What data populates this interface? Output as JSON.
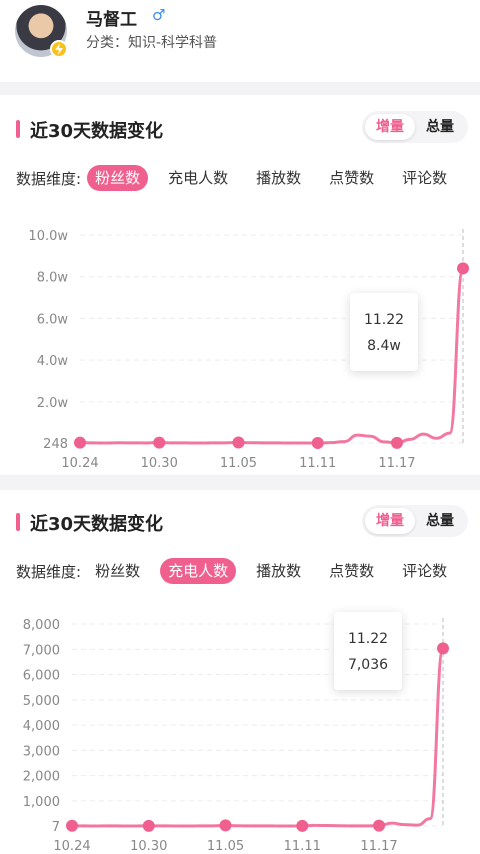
{
  "profile": {
    "name": "马督工",
    "gender_symbol": "♂",
    "category": "分类：知识-科学科普"
  },
  "colors": {
    "accent": "#f0608f",
    "gender": "#3b8ee8",
    "badge": "#f6c21d"
  },
  "icons": {
    "gender": "male-icon",
    "badge": "lightning-badge-icon"
  },
  "cards": [
    {
      "title": "近30天数据变化",
      "toggle": [
        "增量",
        "总量"
      ],
      "toggle_active": 0,
      "dim_label": "数据维度:",
      "dims": [
        "粉丝数",
        "充电人数",
        "播放数",
        "点赞数",
        "评论数"
      ],
      "dim_active": 0,
      "tooltip": {
        "date": "11.22",
        "value": "8.4w"
      }
    },
    {
      "title": "近30天数据变化",
      "toggle": [
        "增量",
        "总量"
      ],
      "toggle_active": 0,
      "dim_label": "数据维度:",
      "dims": [
        "粉丝数",
        "充电人数",
        "播放数",
        "点赞数",
        "评论数"
      ],
      "dim_active": 1,
      "tooltip": {
        "date": "11.22",
        "value": "7,036"
      }
    }
  ],
  "chart_data": [
    {
      "type": "line",
      "metric": "粉丝数",
      "y_tick_labels": [
        "248",
        "2.0w",
        "4.0w",
        "6.0w",
        "8.0w",
        "10.0w"
      ],
      "y_ticks": [
        248,
        20000,
        40000,
        60000,
        80000,
        100000
      ],
      "ylim": [
        248,
        100000
      ],
      "x_tick_labels": [
        "10.24",
        "10.30",
        "11.05",
        "11.11",
        "11.17"
      ],
      "x": [
        "10.24",
        "10.25",
        "10.26",
        "10.27",
        "10.28",
        "10.29",
        "10.30",
        "10.31",
        "11.01",
        "11.02",
        "11.03",
        "11.04",
        "11.05",
        "11.06",
        "11.07",
        "11.08",
        "11.09",
        "11.10",
        "11.11",
        "11.12",
        "11.13",
        "11.14",
        "11.15",
        "11.16",
        "11.17",
        "11.18",
        "11.19",
        "11.20",
        "11.21",
        "11.22"
      ],
      "values": [
        400,
        300,
        250,
        350,
        300,
        260,
        420,
        300,
        280,
        250,
        300,
        320,
        500,
        380,
        300,
        280,
        260,
        250,
        270,
        400,
        900,
        4000,
        3500,
        800,
        300,
        2000,
        4500,
        2500,
        5000,
        84000
      ],
      "grid": true,
      "color": "#f0608f"
    },
    {
      "type": "line",
      "metric": "充电人数",
      "y_tick_labels": [
        "7",
        "1,000",
        "2,000",
        "3,000",
        "4,000",
        "5,000",
        "6,000",
        "7,000",
        "8,000"
      ],
      "y_ticks": [
        7,
        1000,
        2000,
        3000,
        4000,
        5000,
        6000,
        7000,
        8000
      ],
      "ylim": [
        7,
        8000
      ],
      "x_tick_labels": [
        "10.24",
        "10.30",
        "11.05",
        "11.11",
        "11.17"
      ],
      "x": [
        "10.24",
        "10.25",
        "10.26",
        "10.27",
        "10.28",
        "10.29",
        "10.30",
        "10.31",
        "11.01",
        "11.02",
        "11.03",
        "11.04",
        "11.05",
        "11.06",
        "11.07",
        "11.08",
        "11.09",
        "11.10",
        "11.11",
        "11.12",
        "11.13",
        "11.14",
        "11.15",
        "11.16",
        "11.17",
        "11.18",
        "11.19",
        "11.20",
        "11.21",
        "11.22"
      ],
      "values": [
        15,
        10,
        8,
        12,
        9,
        8,
        14,
        10,
        9,
        8,
        10,
        12,
        30,
        15,
        12,
        10,
        9,
        8,
        10,
        30,
        25,
        15,
        12,
        10,
        20,
        120,
        60,
        40,
        300,
        7036
      ],
      "grid": true,
      "color": "#f0608f"
    }
  ]
}
